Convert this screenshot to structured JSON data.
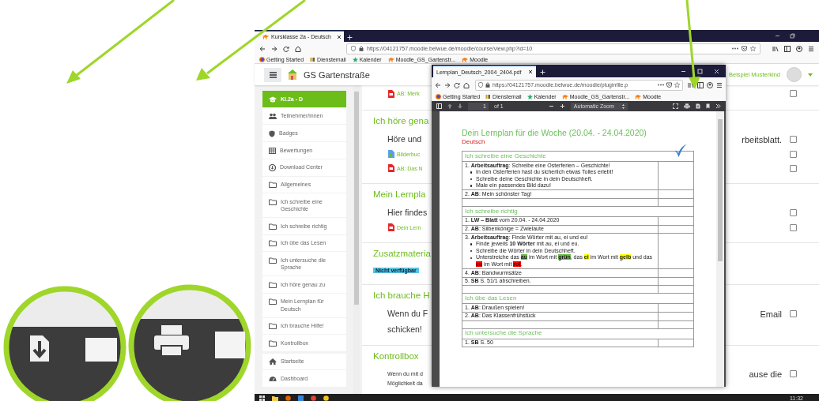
{
  "browser": {
    "tab_title": "Kursklasse 2a - Deutsch",
    "url": "https://04121757.moodle.belwue.de/moodle/course/view.php?id=10",
    "bookmarks": [
      {
        "label": "Getting Started",
        "kind": "browser"
      },
      {
        "label": "Dienstemail",
        "kind": "mail"
      },
      {
        "label": "Kalender",
        "kind": "calendar"
      },
      {
        "label": "Moodle_GS_Gartenstr...",
        "kind": "moodle"
      },
      {
        "label": "Moodle",
        "kind": "moodle"
      }
    ]
  },
  "site": {
    "name": "GS Gartenstraße",
    "user": "Beispiel Musterkind"
  },
  "sidebar": {
    "items": [
      {
        "label": "Kl.2a - D",
        "kind": "course",
        "selected": true
      },
      {
        "label": "Teilnehmer/innen",
        "kind": "participants",
        "selected": false
      },
      {
        "label": "Badges",
        "kind": "badges",
        "selected": false
      },
      {
        "label": "Bewertungen",
        "kind": "grades",
        "selected": false
      },
      {
        "label": "Download Center",
        "kind": "download",
        "selected": false
      },
      {
        "label": "Allgemeines",
        "kind": "section",
        "selected": false
      },
      {
        "label": "Ich schreibe eine Geschichte",
        "kind": "section",
        "selected": false
      },
      {
        "label": "Ich schreibe richtig",
        "kind": "section",
        "selected": false
      },
      {
        "label": "Ich übe das Lesen",
        "kind": "section",
        "selected": false
      },
      {
        "label": "Ich untersuche die Sprache",
        "kind": "section",
        "selected": false
      },
      {
        "label": "Ich höre genau zu",
        "kind": "section",
        "selected": false
      },
      {
        "label": "Mein Lernplan für Deutsch",
        "kind": "section",
        "selected": false
      },
      {
        "label": "Ich brauche Hilfe!",
        "kind": "section",
        "selected": false
      },
      {
        "label": "Kontrollbox",
        "kind": "section",
        "selected": false
      }
    ],
    "links": [
      {
        "label": "Startseite",
        "kind": "home",
        "selected": false
      },
      {
        "label": "Dashboard",
        "kind": "dashboard",
        "selected": false
      }
    ]
  },
  "content": {
    "rows": [
      {
        "kind": "pdf",
        "left": "AB: Merk",
        "checkbox": {
          "checked": false
        }
      },
      {
        "kind": "heading",
        "left": "Ich höre gena"
      },
      {
        "kind": "text",
        "left": "Höre und",
        "right": "rbeitsblatt.",
        "checkbox": {
          "checked": false
        }
      },
      {
        "kind": "file",
        "left": "Bilderbuc",
        "checkbox": {
          "checked": false
        }
      },
      {
        "kind": "pdf",
        "left": "AB: Das N",
        "checkbox": {
          "checked": false
        }
      },
      {
        "kind": "heading",
        "left": "Mein Lernpla"
      },
      {
        "kind": "text",
        "left": "Hier findes",
        "checkbox": {
          "checked": false
        }
      },
      {
        "kind": "pdf",
        "left": "Dein Lern",
        "checkbox": {
          "checked": false
        }
      },
      {
        "kind": "heading",
        "left": "Zusatzmateria"
      },
      {
        "kind": "badge",
        "left": "Nicht verfügbar"
      },
      {
        "kind": "heading",
        "left": "Ich brauche H"
      },
      {
        "kind": "text",
        "left": "Wenn du F",
        "right": "Email",
        "checkbox": {
          "checked": false
        }
      },
      {
        "kind": "text",
        "left": "schicken!"
      },
      {
        "kind": "heading",
        "left": "Kontrollbox"
      },
      {
        "kind": "small",
        "left": "Wenn du mit d",
        "right": "ause die",
        "checkbox": {
          "checked": false
        }
      },
      {
        "kind": "small",
        "left": "Möglichkeit da"
      }
    ]
  },
  "pdf_window": {
    "tab_title": "Lernplan_Deutsch_2004_2404.pdf",
    "url": "https://04121757.moodle.belwue.de/moodle/pluginfile.p",
    "bookmarks": [
      {
        "label": "Getting Started",
        "kind": "browser"
      },
      {
        "label": "Dienstemail",
        "kind": "mail"
      },
      {
        "label": "Kalender",
        "kind": "calendar"
      },
      {
        "label": "Moodle_GS_Gartenstr...",
        "kind": "moodle"
      },
      {
        "label": "Moodle",
        "kind": "moodle"
      }
    ],
    "toolbar": {
      "page": "1",
      "page_count": "of 1",
      "zoom": "Automatic Zoom"
    },
    "document": {
      "title": "Dein Lernplan für die Woche (20.04. - 24.04.2020)",
      "subject": "Deutsch",
      "sections": [
        {
          "heading": "Ich schreibe eine Geschichte",
          "checkmark": true,
          "rows": [
            {
              "kind": "item",
              "text": "1. **Arbeitsauftrag**: Schreibe eine Osterferien – Geschichte!",
              "bullets": [
                {
                  "text": "In den Osterferien hast du sicherlich etwas Tolles erlebt!"
                },
                {
                  "text": "Schreibe deine Geschichte in dein Deutschheft."
                },
                {
                  "text": "Male ein passendes Bild dazu!"
                }
              ]
            },
            {
              "kind": "item",
              "text": "2. **AB**: Mein schönster Tag!"
            },
            {
              "kind": "blank"
            }
          ]
        },
        {
          "heading": "Ich schreibe richtig",
          "checkmark": false,
          "rows": [
            {
              "kind": "item",
              "text": "1. **LW – Blatt** vom 20.04. - 24.04.2020"
            },
            {
              "kind": "item",
              "text": "2. **AB**: Silbenkönige = Zwielaute"
            },
            {
              "kind": "item",
              "text": "3. **Arbeitsauftrag**: Finde Wörter mit au, ei und eu!",
              "bullets": [
                {
                  "text": "Finde jeweils **10 Wörter** mit au, ei und eu."
                },
                {
                  "text": "Schreibe die Wörter in dein Deutschheft."
                },
                {
                  "parts": [
                    {
                      "text": "Unterstreiche das "
                    },
                    {
                      "text": "au",
                      "color": "#6abf4b"
                    },
                    {
                      "text": " im Wort mit "
                    },
                    {
                      "text": "grün",
                      "color": "#6abf4b"
                    },
                    {
                      "text": ", das "
                    },
                    {
                      "text": "ei",
                      "color": "#ffff00"
                    },
                    {
                      "text": " im Wort mit "
                    },
                    {
                      "text": "gelb",
                      "color": "#ffff00"
                    },
                    {
                      "text": " und das "
                    },
                    {
                      "text": "eu",
                      "color": "#ff0000"
                    },
                    {
                      "text": " im Wort mit "
                    },
                    {
                      "text": "rot",
                      "color": "#ff0000"
                    },
                    {
                      "text": "."
                    }
                  ]
                }
              ]
            },
            {
              "kind": "item",
              "text": "4. **AB**: Bandwurmsätze"
            },
            {
              "kind": "item",
              "text": "5. **SB** S. 51/1 abschreiben."
            },
            {
              "kind": "blank"
            }
          ]
        },
        {
          "heading": "Ich übe das Lesen",
          "checkmark": false,
          "rows": [
            {
              "kind": "item",
              "text": "1. **AB**: Draußen spielen!"
            },
            {
              "kind": "item",
              "text": "2. **AB**: Das Klassenfrühstück"
            },
            {
              "kind": "blank"
            }
          ]
        },
        {
          "heading": "Ich untersuche die Sprache",
          "checkmark": false,
          "rows": [
            {
              "kind": "item",
              "text": "1. **SB** S. 50"
            }
          ]
        }
      ]
    }
  },
  "taskbar": {
    "time": "11:32"
  }
}
